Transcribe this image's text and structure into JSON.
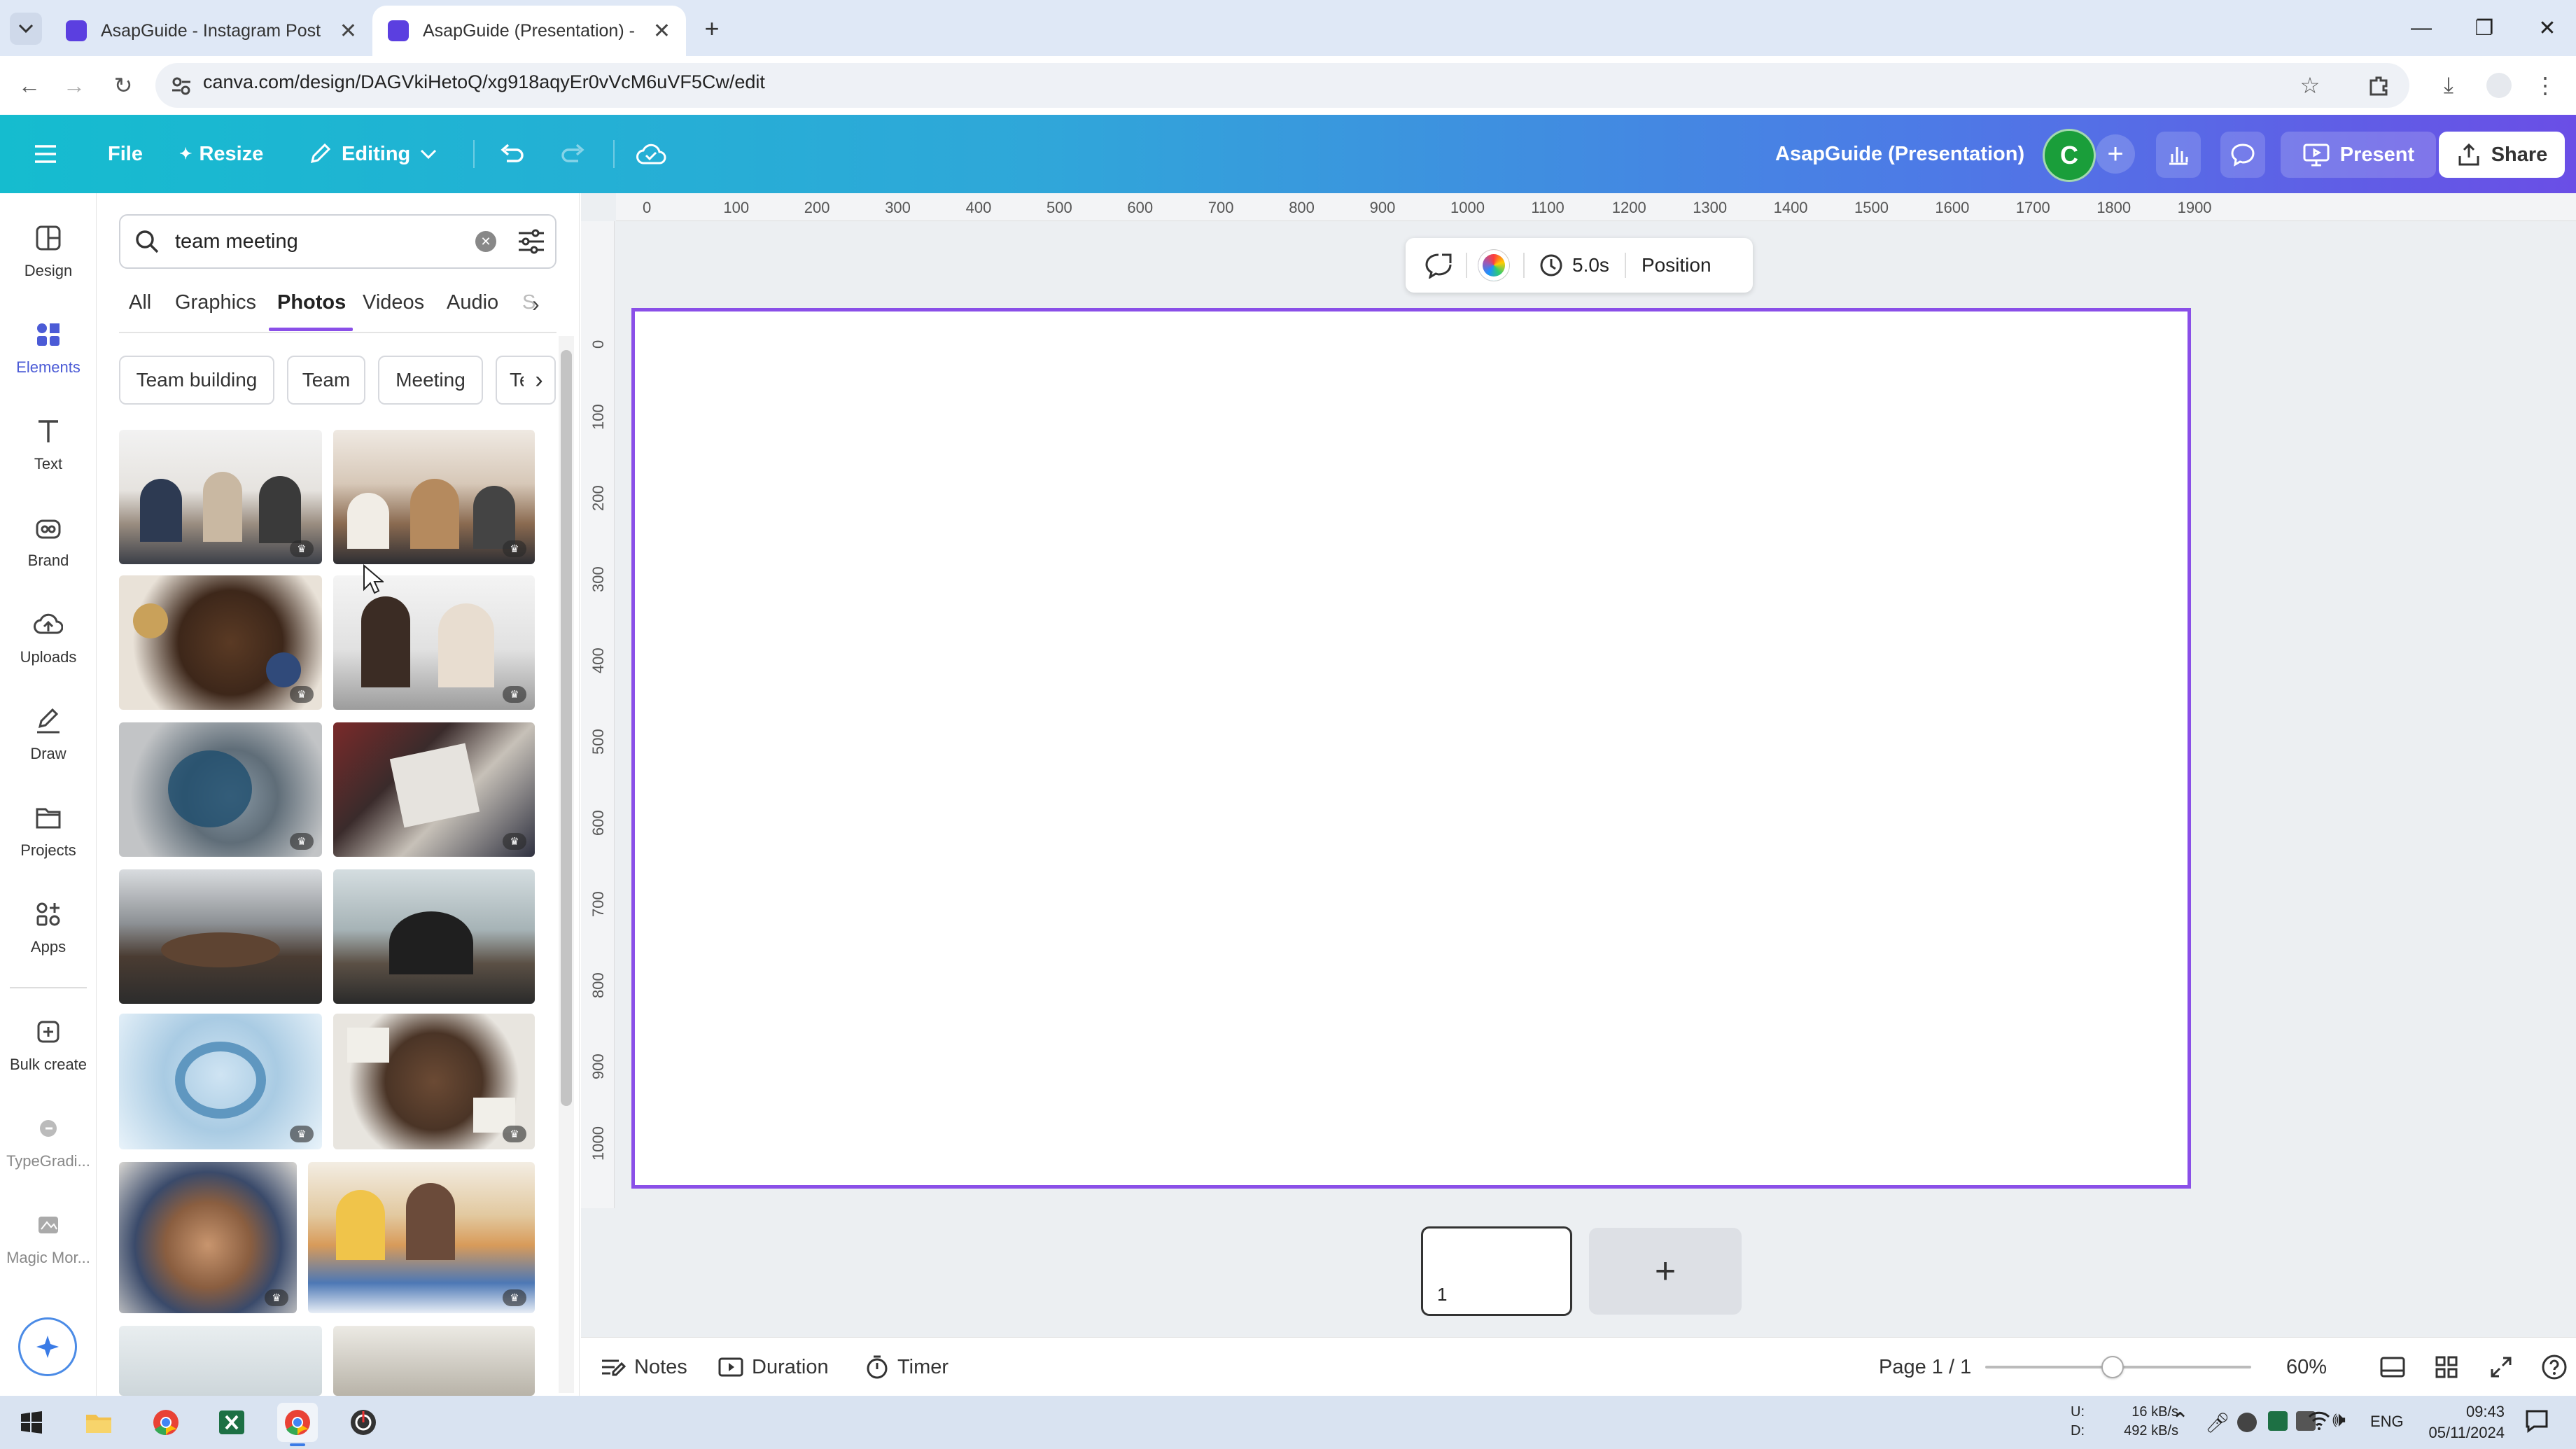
{
  "browser": {
    "tabs": [
      {
        "title": "AsapGuide - Instagram Post"
      },
      {
        "title": "AsapGuide (Presentation) - Pre"
      }
    ],
    "url": "canva.com/design/DAGVkiHetoQ/xg918aqyEr0vVcM6uVF5Cw/edit"
  },
  "header": {
    "file": "File",
    "resize": "Resize",
    "editing": "Editing",
    "title": "AsapGuide (Presentation)",
    "avatar": "C",
    "present": "Present",
    "share": "Share"
  },
  "rail": [
    {
      "label": "Design",
      "icon": "design-icon"
    },
    {
      "label": "Elements",
      "icon": "elements-icon"
    },
    {
      "label": "Text",
      "icon": "text-icon"
    },
    {
      "label": "Brand",
      "icon": "brand-icon"
    },
    {
      "label": "Uploads",
      "icon": "uploads-icon"
    },
    {
      "label": "Draw",
      "icon": "draw-icon"
    },
    {
      "label": "Projects",
      "icon": "projects-icon"
    },
    {
      "label": "Apps",
      "icon": "apps-icon"
    },
    {
      "label": "Bulk create",
      "icon": "bulk-create-icon"
    },
    {
      "label": "TypeGradi...",
      "icon": "typegradient-icon"
    },
    {
      "label": "Magic Mor...",
      "icon": "magic-morph-icon"
    }
  ],
  "panel": {
    "search_value": "team meeting",
    "tabs": [
      "All",
      "Graphics",
      "Photos",
      "Videos",
      "Audio",
      "S"
    ],
    "active_tab": "Photos",
    "chips": [
      "Team building",
      "Team",
      "Meeting",
      "Te"
    ]
  },
  "ruler": {
    "top": [
      "0",
      "100",
      "200",
      "300",
      "400",
      "500",
      "600",
      "700",
      "800",
      "900",
      "1000",
      "1100",
      "1200",
      "1300",
      "1400",
      "1500",
      "1600",
      "1700",
      "1800",
      "1900"
    ],
    "left": [
      "0",
      "100",
      "200",
      "300",
      "400",
      "500",
      "600",
      "700",
      "800",
      "900",
      "1000"
    ]
  },
  "context_toolbar": {
    "duration": "5.0s",
    "position": "Position"
  },
  "pages": {
    "thumb_number": "1",
    "add": "+"
  },
  "footer": {
    "notes": "Notes",
    "duration": "Duration",
    "timer": "Timer",
    "page_indicator": "Page 1 / 1",
    "zoom": "60%",
    "zoom_level": 0.48
  },
  "taskbar": {
    "net_up_label": "U:",
    "net_down_label": "D:",
    "net_up": "16 kB/s",
    "net_down": "492 kB/s",
    "lang": "ENG",
    "time": "09:43",
    "date": "05/11/2024"
  },
  "colors": {
    "accent": "#8a4fe8",
    "avatar_green": "#1a9e3a",
    "header_start": "#15bccf",
    "header_end": "#6a4ee6"
  }
}
